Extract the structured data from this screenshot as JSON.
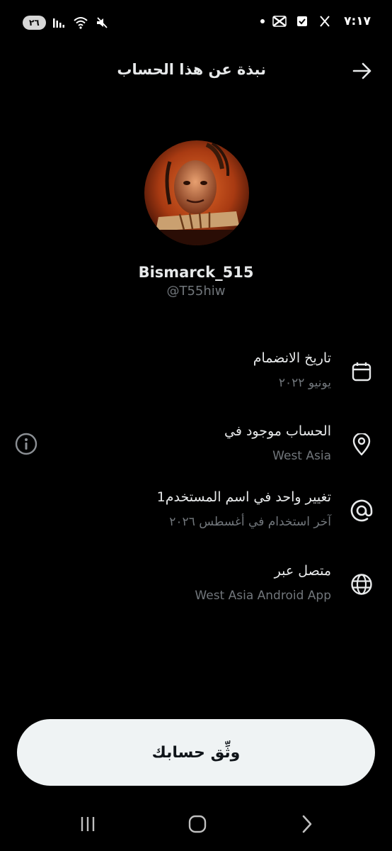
{
  "status_bar": {
    "battery": "٢٦",
    "time": "٧:١٧",
    "icons": [
      "battery-icon",
      "signal-icon",
      "wifi-icon",
      "mute-icon",
      "notification-dot-icon",
      "capcut-icon",
      "check-square-icon",
      "x-logo-icon"
    ]
  },
  "header": {
    "title": "نبذة عن هذا الحساب",
    "back_icon": "arrow-right-icon"
  },
  "profile": {
    "display_name": "Bismarck_515",
    "handle": "@T55hiw"
  },
  "info_rows": [
    {
      "label": "تاريخ الانضمام",
      "value": "يونيو ٢٠٢٢",
      "icon": "calendar-icon"
    },
    {
      "label": "الحساب موجود في",
      "value": "West Asia",
      "icon": "location-pin-icon",
      "action_icon": "info-icon"
    },
    {
      "label": "تغيير واحد في اسم المستخدم1",
      "value": "آخر استخدام في أغسطس ٢٠٢٦",
      "icon": "at-sign-icon"
    },
    {
      "label": "متصل عبر",
      "value": "West Asia Android App",
      "icon": "globe-icon"
    }
  ],
  "verify_button": {
    "label": "وثِّق حسابك"
  },
  "nav_bar": {
    "buttons": [
      "recent-apps-icon",
      "home-icon",
      "back-chevron-icon"
    ]
  },
  "colors": {
    "background": "#000000",
    "primary_text": "#e7e9ea",
    "secondary_text": "#71767b",
    "button_bg": "#eff3f4",
    "button_text": "#0f1419"
  }
}
